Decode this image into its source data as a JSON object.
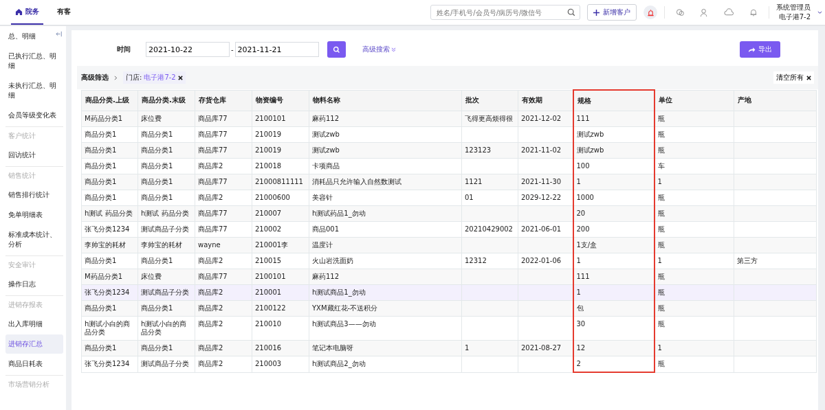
{
  "topbar": {
    "tabs": [
      {
        "label": "院务",
        "selected": true
      },
      {
        "label": "有客",
        "selected": false
      }
    ],
    "search": {
      "placeholder": "姓名/手机号/会员号/病历号/微信号"
    },
    "add_button": "新增客户",
    "user": {
      "name": "系统管理员",
      "store": "电子港7-2"
    }
  },
  "sidebar": {
    "items": [
      {
        "label": "总、明细",
        "kind": "link",
        "selected": false
      },
      {
        "label": "已执行汇总、明细",
        "kind": "link",
        "selected": false
      },
      {
        "label": "未执行汇总、明细",
        "kind": "link",
        "selected": false
      },
      {
        "label": "会员等级变化表",
        "kind": "link",
        "selected": false
      },
      {
        "label": "客户统计",
        "kind": "group"
      },
      {
        "label": "回访统计",
        "kind": "link",
        "selected": false
      },
      {
        "label": "销售统计",
        "kind": "group"
      },
      {
        "label": "销售排行统计",
        "kind": "link",
        "selected": false
      },
      {
        "label": "免单明细表",
        "kind": "link",
        "selected": false
      },
      {
        "label": "标准成本统计、分析",
        "kind": "link",
        "selected": false
      },
      {
        "label": "安全审计",
        "kind": "group"
      },
      {
        "label": "操作日志",
        "kind": "link",
        "selected": false
      },
      {
        "label": "进销存报表",
        "kind": "group"
      },
      {
        "label": "出入库明细",
        "kind": "link",
        "selected": false
      },
      {
        "label": "进销存汇总",
        "kind": "link",
        "selected": true
      },
      {
        "label": "商品日耗表",
        "kind": "link",
        "selected": false
      },
      {
        "label": "市场营销分析",
        "kind": "group"
      }
    ]
  },
  "filters": {
    "time_label": "时间",
    "start_date": "2021-10-22",
    "separator": "-",
    "end_date": "2021-11-21",
    "advanced_search": "高级搜索",
    "export_button": "导出"
  },
  "filter_bar": {
    "title": "高级筛选",
    "tag_label": "门店:",
    "tag_value": "电子港7-2",
    "clear_all": "清空所有"
  },
  "table": {
    "columns": [
      {
        "label": "商品分类.上级",
        "highlighted": false
      },
      {
        "label": "商品分类.末级",
        "highlighted": false
      },
      {
        "label": "存货仓库",
        "highlighted": false
      },
      {
        "label": "物资编号",
        "highlighted": false
      },
      {
        "label": "物料名称",
        "highlighted": false
      },
      {
        "label": "批次",
        "highlighted": false
      },
      {
        "label": "有效期",
        "highlighted": false
      },
      {
        "label": "规格",
        "highlighted": true
      },
      {
        "label": "单位",
        "highlighted": false
      },
      {
        "label": "产地",
        "highlighted": false
      }
    ],
    "rows": [
      {
        "selected": false,
        "cells": [
          "M药品分类1",
          "床位费",
          "商品库77",
          "2100101",
          "麻药112",
          "飞得更高烦得很",
          "2021-12-02",
          "111",
          "瓶",
          ""
        ]
      },
      {
        "selected": false,
        "cells": [
          "商品分类1",
          "商品分类1",
          "商品库77",
          "210019",
          "测试zwb",
          "",
          "",
          "测试zwb",
          "瓶",
          ""
        ]
      },
      {
        "selected": false,
        "cells": [
          "商品分类1",
          "商品分类1",
          "商品库77",
          "210019",
          "测试zwb",
          "123123",
          "2021-11-02",
          "测试zwb",
          "瓶",
          ""
        ]
      },
      {
        "selected": false,
        "cells": [
          "商品分类1",
          "商品分类1",
          "商品库2",
          "210018",
          "卡项商品",
          "",
          "",
          "100",
          "车",
          ""
        ]
      },
      {
        "selected": false,
        "cells": [
          "商品分类1",
          "商品分类1",
          "商品库77",
          "21000811111",
          "消耗品只允许输入自然数测试",
          "1121",
          "2021-11-30",
          "1",
          "1",
          ""
        ]
      },
      {
        "selected": false,
        "cells": [
          "商品分类1",
          "商品分类1",
          "商品库2",
          "21000600",
          "美容针",
          "01",
          "2029-12-22",
          "1000",
          "瓶",
          ""
        ]
      },
      {
        "selected": false,
        "cells": [
          "h测试 药品分类",
          "h测试 药品分类",
          "商品库77",
          "210007",
          "h测试药品1_勿动",
          "",
          "",
          "20",
          "瓶",
          ""
        ]
      },
      {
        "selected": false,
        "cells": [
          "张飞分类1234",
          "测试商品子分类",
          "商品库77",
          "210002",
          "商品001",
          "20210429002",
          "2021-06-01",
          "200",
          "瓶",
          ""
        ]
      },
      {
        "selected": false,
        "cells": [
          "李帅宝的耗材",
          "李帅宝的耗材",
          "wayne",
          "210001李",
          "温度计",
          "",
          "",
          "1支/盒",
          "瓶",
          ""
        ]
      },
      {
        "selected": false,
        "cells": [
          "商品分类1",
          "商品分类1",
          "商品库2",
          "210015",
          "火山岩洗面奶",
          "12312",
          "2022-01-06",
          "1",
          "1",
          "第三方"
        ]
      },
      {
        "selected": false,
        "cells": [
          "M药品分类1",
          "床位费",
          "商品库77",
          "2100101",
          "麻药112",
          "",
          "",
          "111",
          "瓶",
          ""
        ]
      },
      {
        "selected": true,
        "cells": [
          "张飞分类1234",
          "测试商品子分类",
          "商品库2",
          "210001",
          "h测试商品1_勿动",
          "",
          "",
          "1",
          "瓶",
          ""
        ]
      },
      {
        "selected": false,
        "cells": [
          "商品分类1",
          "商品分类1",
          "商品库2",
          "2100122",
          "YXM藏红花-不送积分",
          "",
          "",
          "包",
          "瓶",
          ""
        ]
      },
      {
        "selected": false,
        "cells": [
          "h测试小白的商品分类",
          "h测试小白的商品分类",
          "商品库2",
          "210010",
          "h测试商品3——勿动",
          "",
          "",
          "30",
          "瓶",
          ""
        ]
      },
      {
        "selected": false,
        "cells": [
          "商品分类1",
          "商品分类1",
          "商品库2",
          "210016",
          "笔记本电脑呀",
          "1",
          "2021-08-27",
          "12",
          "1",
          ""
        ]
      },
      {
        "selected": false,
        "cells": [
          "张飞分类1234",
          "测试商品子分类",
          "商品库2",
          "210003",
          "h测试商品2_勿动",
          "",
          "",
          "2",
          "瓶",
          ""
        ]
      }
    ]
  }
}
